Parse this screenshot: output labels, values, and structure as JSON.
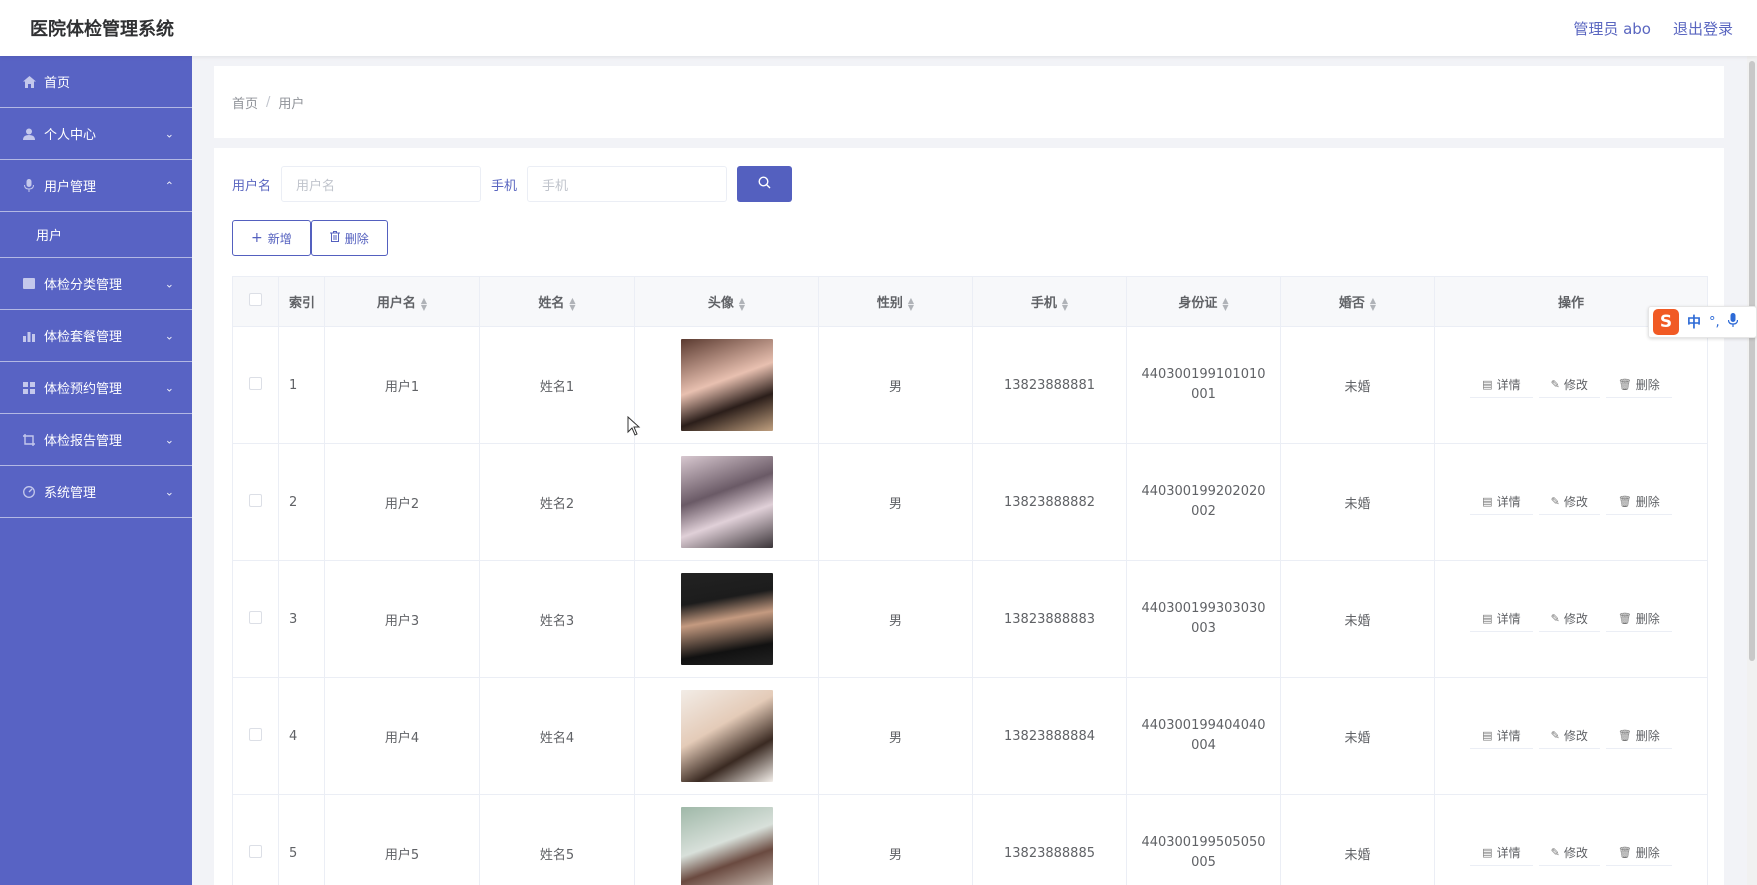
{
  "app": {
    "title": "医院体检管理系统"
  },
  "header": {
    "user_label": "管理员 abo",
    "logout_label": "退出登录"
  },
  "sidebar": {
    "items": [
      {
        "label": "首页",
        "icon": "home-icon",
        "chevron": ""
      },
      {
        "label": "个人中心",
        "icon": "user-icon",
        "chevron": "⌄"
      },
      {
        "label": "用户管理",
        "icon": "mic-icon",
        "chevron": "⌃"
      },
      {
        "label": "用户",
        "icon": "",
        "chevron": ""
      },
      {
        "label": "体检分类管理",
        "icon": "folder-icon",
        "chevron": "⌄"
      },
      {
        "label": "体检套餐管理",
        "icon": "bar-chart-icon",
        "chevron": "⌄"
      },
      {
        "label": "体检预约管理",
        "icon": "grid-icon",
        "chevron": "⌄"
      },
      {
        "label": "体检报告管理",
        "icon": "crop-icon",
        "chevron": "⌄"
      },
      {
        "label": "系统管理",
        "icon": "gauge-icon",
        "chevron": "⌄"
      }
    ]
  },
  "breadcrumb": {
    "home": "首页",
    "separator": "/",
    "current": "用户"
  },
  "search": {
    "username_label": "用户名",
    "username_placeholder": "用户名",
    "phone_label": "手机",
    "phone_placeholder": "手机"
  },
  "actions": {
    "add_label": "新增",
    "delete_label": "删除"
  },
  "table": {
    "headers": {
      "index": "索引",
      "username": "用户名",
      "name": "姓名",
      "avatar": "头像",
      "gender": "性别",
      "phone": "手机",
      "idcard": "身份证",
      "married": "婚否",
      "ops": "操作"
    },
    "op_labels": {
      "detail": "详情",
      "edit": "修改",
      "delete": "删除"
    },
    "rows": [
      {
        "index": "1",
        "username": "用户1",
        "name": "姓名1",
        "gender": "男",
        "phone": "13823888881",
        "idcard": "440300199101010001",
        "married": "未婚"
      },
      {
        "index": "2",
        "username": "用户2",
        "name": "姓名2",
        "gender": "男",
        "phone": "13823888882",
        "idcard": "440300199202020002",
        "married": "未婚"
      },
      {
        "index": "3",
        "username": "用户3",
        "name": "姓名3",
        "gender": "男",
        "phone": "13823888883",
        "idcard": "440300199303030003",
        "married": "未婚"
      },
      {
        "index": "4",
        "username": "用户4",
        "name": "姓名4",
        "gender": "男",
        "phone": "13823888884",
        "idcard": "440300199404040004",
        "married": "未婚"
      },
      {
        "index": "5",
        "username": "用户5",
        "name": "姓名5",
        "gender": "男",
        "phone": "13823888885",
        "idcard": "440300199505050005",
        "married": "未婚"
      }
    ]
  },
  "ime": {
    "logo": "S",
    "lang": "中",
    "punct": "°,",
    "mic": "🎙"
  },
  "colors": {
    "sidebar_bg": "#5863c4",
    "accent": "#5460bf",
    "link": "#5a66c0"
  }
}
